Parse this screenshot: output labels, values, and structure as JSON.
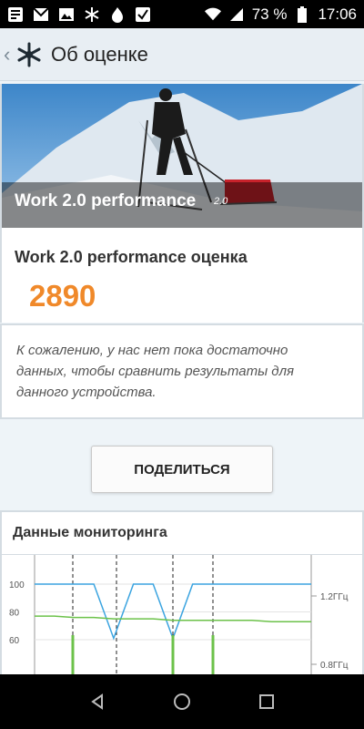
{
  "status_bar": {
    "battery_text": "73 %",
    "time": "17:06"
  },
  "app_bar": {
    "title": "Об оценке"
  },
  "hero": {
    "label": "Work 2.0 performance",
    "version": "2.0"
  },
  "score": {
    "title": "Work 2.0 performance оценка",
    "value": "2890"
  },
  "message": {
    "text": "К сожалению, у нас нет пока достаточно данных, чтобы сравнить результаты для данного устройства."
  },
  "share_button": {
    "label": "ПОДЕЛИТЬСЯ"
  },
  "monitoring": {
    "title": "Данные мониторинга"
  },
  "chart_data": {
    "type": "line",
    "y_ticks": [
      "100",
      "80",
      "60"
    ],
    "y2_ticks": [
      "1.2ГГц",
      "0.8ГГц"
    ],
    "series": [
      {
        "values": [
          100,
          100,
          100,
          100,
          61,
          100,
          100,
          61,
          100,
          100,
          100,
          100,
          100,
          100,
          100
        ]
      },
      {
        "values": [
          77,
          77,
          76,
          76,
          75,
          75,
          75,
          74,
          74,
          74,
          74,
          74,
          73,
          73,
          73
        ]
      }
    ],
    "colors": {
      "battery": "#3ba4e0",
      "temperature": "#6cc24a",
      "markers": "#222222"
    }
  }
}
